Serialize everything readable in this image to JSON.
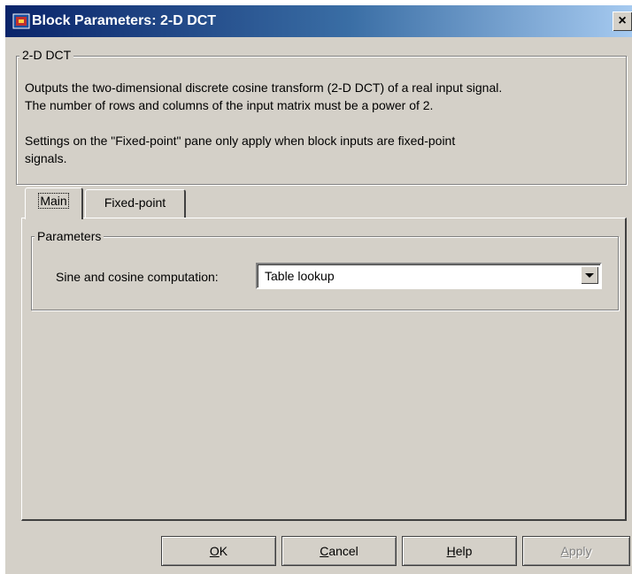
{
  "window": {
    "title": "Block Parameters: 2-D DCT",
    "close_label": "×"
  },
  "description": {
    "group_title": "2-D DCT",
    "line1": "Outputs the two-dimensional discrete cosine transform (2-D DCT) of a real input signal.",
    "line2": "The number of rows and columns of the input matrix must be a power of 2.",
    "line3": "Settings on the \"Fixed-point\" pane only apply when block inputs are fixed-point",
    "line4": "signals."
  },
  "tabs": [
    {
      "label": "Main",
      "active": true
    },
    {
      "label": "Fixed-point",
      "active": false
    }
  ],
  "parameters": {
    "group_title": "Parameters",
    "sine_cosine_label": "Sine and cosine computation:",
    "sine_cosine_value": "Table lookup"
  },
  "buttons": {
    "ok": {
      "accel": "O",
      "rest": "K"
    },
    "cancel": {
      "accel": "C",
      "rest": "ancel"
    },
    "help": {
      "accel": "H",
      "rest": "elp"
    },
    "apply": {
      "accel": "A",
      "rest": "pply",
      "disabled": true
    }
  }
}
